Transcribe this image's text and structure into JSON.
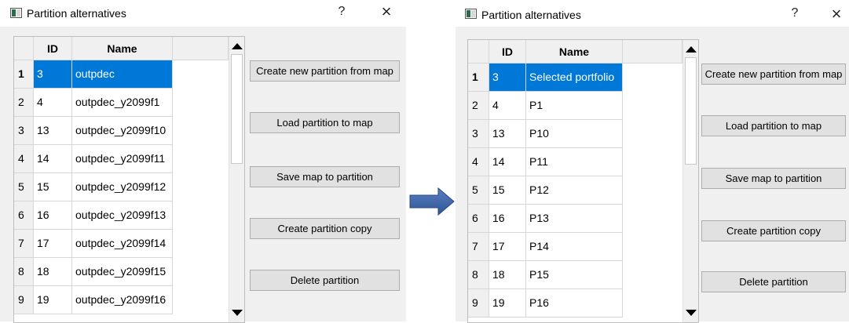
{
  "colors": {
    "selection": "#0078d7",
    "arrow": "#2f5597"
  },
  "dialogs": [
    {
      "title": "Partition alternatives",
      "help": "?",
      "close": "×",
      "columns": [
        "ID",
        "Name"
      ],
      "rows": [
        {
          "num": "1",
          "id": "3",
          "name": "outpdec"
        },
        {
          "num": "2",
          "id": "4",
          "name": "outpdec_y2099f1"
        },
        {
          "num": "3",
          "id": "13",
          "name": "outpdec_y2099f10"
        },
        {
          "num": "4",
          "id": "14",
          "name": "outpdec_y2099f11"
        },
        {
          "num": "5",
          "id": "15",
          "name": "outpdec_y2099f12"
        },
        {
          "num": "6",
          "id": "16",
          "name": "outpdec_y2099f13"
        },
        {
          "num": "7",
          "id": "17",
          "name": "outpdec_y2099f14"
        },
        {
          "num": "8",
          "id": "18",
          "name": "outpdec_y2099f15"
        },
        {
          "num": "9",
          "id": "19",
          "name": "outpdec_y2099f16"
        }
      ],
      "buttons": [
        "Create new partition from map",
        "Load partition to map",
        "Save map to partition",
        "Create partition copy",
        "Delete partition"
      ]
    },
    {
      "title": "Partition alternatives",
      "help": "?",
      "close": "×",
      "columns": [
        "ID",
        "Name"
      ],
      "rows": [
        {
          "num": "1",
          "id": "3",
          "name": "Selected portfolio"
        },
        {
          "num": "2",
          "id": "4",
          "name": "P1"
        },
        {
          "num": "3",
          "id": "13",
          "name": "P10"
        },
        {
          "num": "4",
          "id": "14",
          "name": "P11"
        },
        {
          "num": "5",
          "id": "15",
          "name": "P12"
        },
        {
          "num": "6",
          "id": "16",
          "name": "P13"
        },
        {
          "num": "7",
          "id": "17",
          "name": "P14"
        },
        {
          "num": "8",
          "id": "18",
          "name": "P15"
        },
        {
          "num": "9",
          "id": "19",
          "name": "P16"
        }
      ],
      "buttons": [
        "Create new partition from map",
        "Load partition to map",
        "Save map to partition",
        "Create partition copy",
        "Delete partition"
      ]
    }
  ]
}
